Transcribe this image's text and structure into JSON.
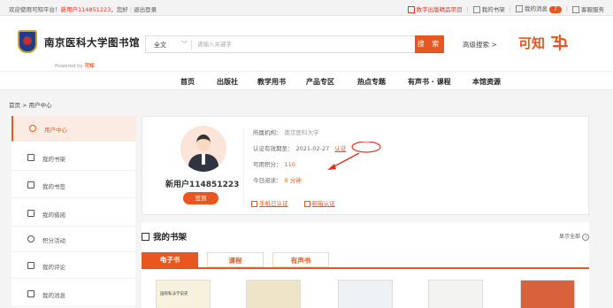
{
  "topbar": {
    "welcome": "欢迎使用可知平台！",
    "username": "新用户114851223",
    "hi": "，您好",
    "logout": "退出登录",
    "digital_product": "数字出版精品项目",
    "my_books": "我的书架",
    "my_messages": "我的消息",
    "message_count": "7",
    "customer_service": "客服服务"
  },
  "header": {
    "library_name": "南京医科大学图书馆",
    "powered_by": "Powered by",
    "powered_brand": "可知",
    "search_scope": "全文",
    "search_placeholder": "请输入关键字",
    "search_button": "搜 索",
    "advanced_search": "高级搜索 >",
    "brand_name": "可知"
  },
  "nav": {
    "items": [
      "首页",
      "出版社",
      "教学用书",
      "产品专区",
      "热点专题",
      "有声书 · 课程",
      "本馆资源"
    ]
  },
  "breadcrumb": "首页 > 用户中心",
  "sidebar": {
    "items": [
      "用户中心",
      "我的书架",
      "我的书签",
      "我的借阅",
      "积分活动",
      "我的评论",
      "我的消息"
    ]
  },
  "profile": {
    "username": "新用户114851223",
    "signin_button": "签到",
    "institution_label": "所属机构：",
    "institution_value": "南京医科大学",
    "auth_expiry_label": "认证有效期至：",
    "auth_expiry_value": "2021-02-27",
    "auth_link": "认证",
    "points_label": "可用积分：",
    "points_value": "110",
    "today_read_label": "今日阅读：",
    "today_read_value": "0 分钟",
    "phone_auth": "手机已认证",
    "email_auth": "邮箱认证"
  },
  "shelf": {
    "title": "我的书架",
    "show_all": "显示全部",
    "tabs": [
      "电子书",
      "课程",
      "有声书"
    ],
    "books": [
      "国际私法学说史",
      "",
      "",
      "",
      ""
    ]
  },
  "colors": {
    "accent": "#e8571f",
    "active_bg": "#fcebe3",
    "callout_arrow": "#e0321f"
  }
}
